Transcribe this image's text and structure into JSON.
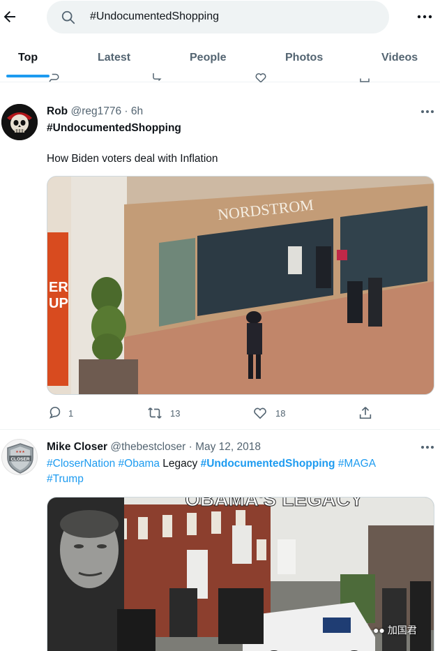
{
  "search": {
    "query": "#UndocumentedShopping"
  },
  "tabs": [
    "Top",
    "Latest",
    "People",
    "Photos",
    "Videos"
  ],
  "tweets": [
    {
      "name": "Rob",
      "handle": "@reg1776",
      "time": "6h",
      "hashtag": "#UndocumentedShopping",
      "text": "How Biden voters deal with Inflation",
      "media_sign": "NORDSTROM",
      "media_sign_left": "ER\nUP",
      "replies": "1",
      "retweets": "13",
      "likes": "18"
    },
    {
      "name": "Mike Closer",
      "handle": "@thebestcloser",
      "date": "May 12, 2018",
      "tags": [
        "#CloserNation",
        "#Obama",
        "Legacy",
        "#UndocumentedShopping",
        "#MAGA",
        "#Trump"
      ],
      "media_caption": "OBAMA'S LEGACY",
      "avatar_text": "CLOSER"
    }
  ],
  "watermark": "加国君",
  "colors": {
    "accent": "#1d9bf0",
    "text": "#0f1419",
    "muted": "#536471"
  }
}
